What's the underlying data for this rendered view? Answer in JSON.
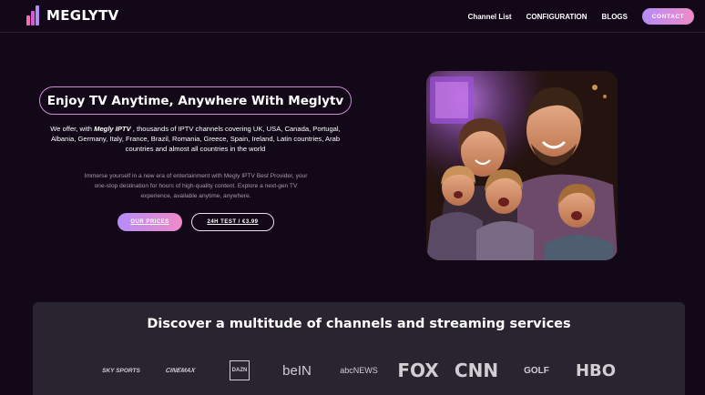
{
  "brand": {
    "name": "MEGLYTV"
  },
  "nav": {
    "links": [
      "Channel List",
      "CONFIGURATION",
      "BLOGS"
    ],
    "contact": "CONTACT"
  },
  "hero": {
    "title": "Enjoy TV Anytime, Anywhere With Meglytv",
    "desc_prefix": "We offer, with ",
    "desc_brand": "Megly IPTV",
    "desc_suffix": " , thousands of IPTV channels covering UK, USA, Canada, Portugal, Albania, Germany, Italy, France, Brazil, Romania, Greece, Spain, Ireland, Latin countries, Arab countries and almost all countries in the world",
    "subtext": "Immerse yourself in a new era of entertainment with Megly IPTV Best Provider, your one-stop destination for hours of high-quality content. Explore a next-gen TV experience, available anytime, anywhere.",
    "btn_prices": "OUR PRICES",
    "btn_test": "24H TEST / €3.99"
  },
  "channels": {
    "title": "Discover a multitude of channels and streaming services",
    "logos": [
      "SKY SPORTS",
      "CINEMAX",
      "DAZN",
      "beIN",
      "abcNEWS",
      "FOX",
      "CNN",
      "GOLF",
      "HBO"
    ]
  },
  "colors": {
    "background": "#120818",
    "accent_start": "#b58cf7",
    "accent_end": "#f08ac8",
    "panel": "#2a2330"
  }
}
